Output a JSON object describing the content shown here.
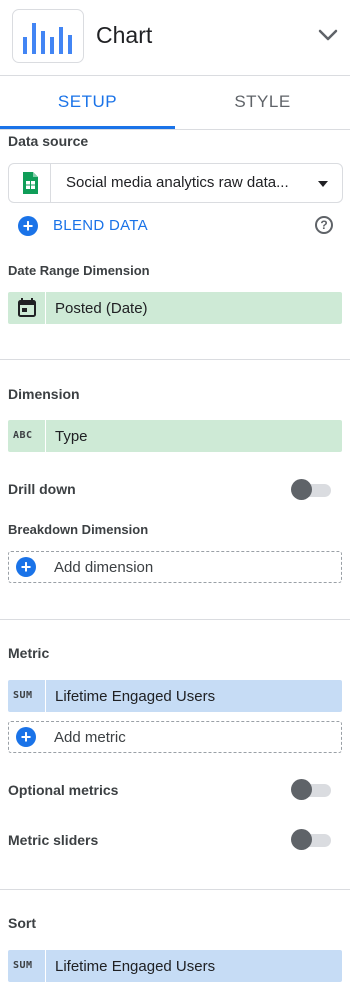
{
  "header": {
    "title": "Chart"
  },
  "tabs": [
    {
      "label": "SETUP"
    },
    {
      "label": "STYLE"
    }
  ],
  "data_source": {
    "label": "Data source",
    "value": "Social media analytics raw data..."
  },
  "blend": {
    "label": "BLEND DATA"
  },
  "date_range": {
    "label": "Date Range Dimension",
    "value": "Posted (Date)"
  },
  "dimension": {
    "label": "Dimension",
    "type_code": "ABC",
    "value": "Type"
  },
  "drill_down": {
    "label": "Drill down",
    "enabled": false
  },
  "breakdown": {
    "label": "Breakdown Dimension",
    "placeholder": "Add dimension"
  },
  "metric": {
    "label": "Metric",
    "agg": "SUM",
    "value": "Lifetime Engaged Users",
    "placeholder": "Add metric"
  },
  "optional_metrics": {
    "label": "Optional metrics",
    "enabled": false
  },
  "metric_sliders": {
    "label": "Metric sliders",
    "enabled": false
  },
  "sort": {
    "label": "Sort",
    "agg": "SUM",
    "value": "Lifetime Engaged Users"
  },
  "colors": {
    "accent": "#1a73e8",
    "dimension_chip": "#ceead6",
    "metric_chip": "#c6dcf5"
  }
}
